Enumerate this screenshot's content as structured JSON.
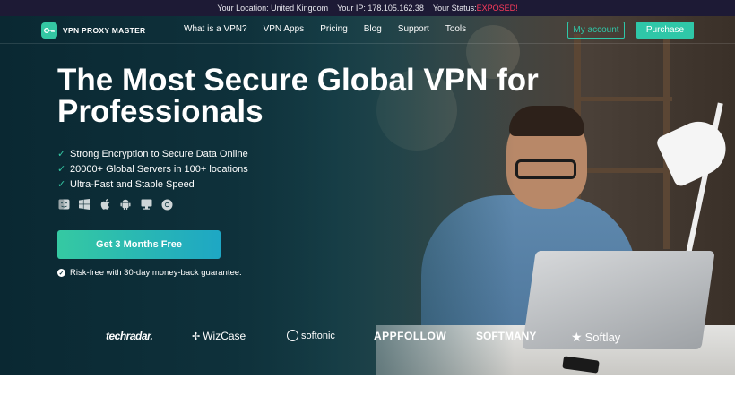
{
  "status_bar": {
    "location_text": "Your Location: United Kingdom",
    "ip_text": "Your IP: 178.105.162.38",
    "status_label": "Your Status:",
    "status_value": "EXPOSED!"
  },
  "nav": {
    "brand": "VPN PROXY MASTER",
    "menu": [
      "What is a VPN?",
      "VPN Apps",
      "Pricing",
      "Blog",
      "Support",
      "Tools"
    ],
    "account_label": "My account",
    "purchase_label": "Purchase"
  },
  "hero": {
    "headline": "The Most Secure Global VPN for Professionals",
    "features": [
      "Strong Encryption to Secure Data Online",
      "20000+ Global Servers in 100+ locations",
      "Ultra-Fast and Stable Speed"
    ],
    "platform_icons": [
      "macos-finder-icon",
      "windows-icon",
      "apple-icon",
      "android-icon",
      "desktop-icon",
      "chrome-icon"
    ],
    "cta_label": "Get 3 Months Free",
    "guarantee_text": "Risk-free with 30-day money-back guarantee."
  },
  "press_logos": [
    "techradar.",
    "WizCase",
    "softonic",
    "APPFOLLOW",
    "SOFTMANY",
    "Softlay"
  ],
  "colors": {
    "accent": "#2fc7a8",
    "status_exposed": "#ff3b5c",
    "topbar_bg": "#1d1a35",
    "hero_dark": "#0d2e38"
  }
}
